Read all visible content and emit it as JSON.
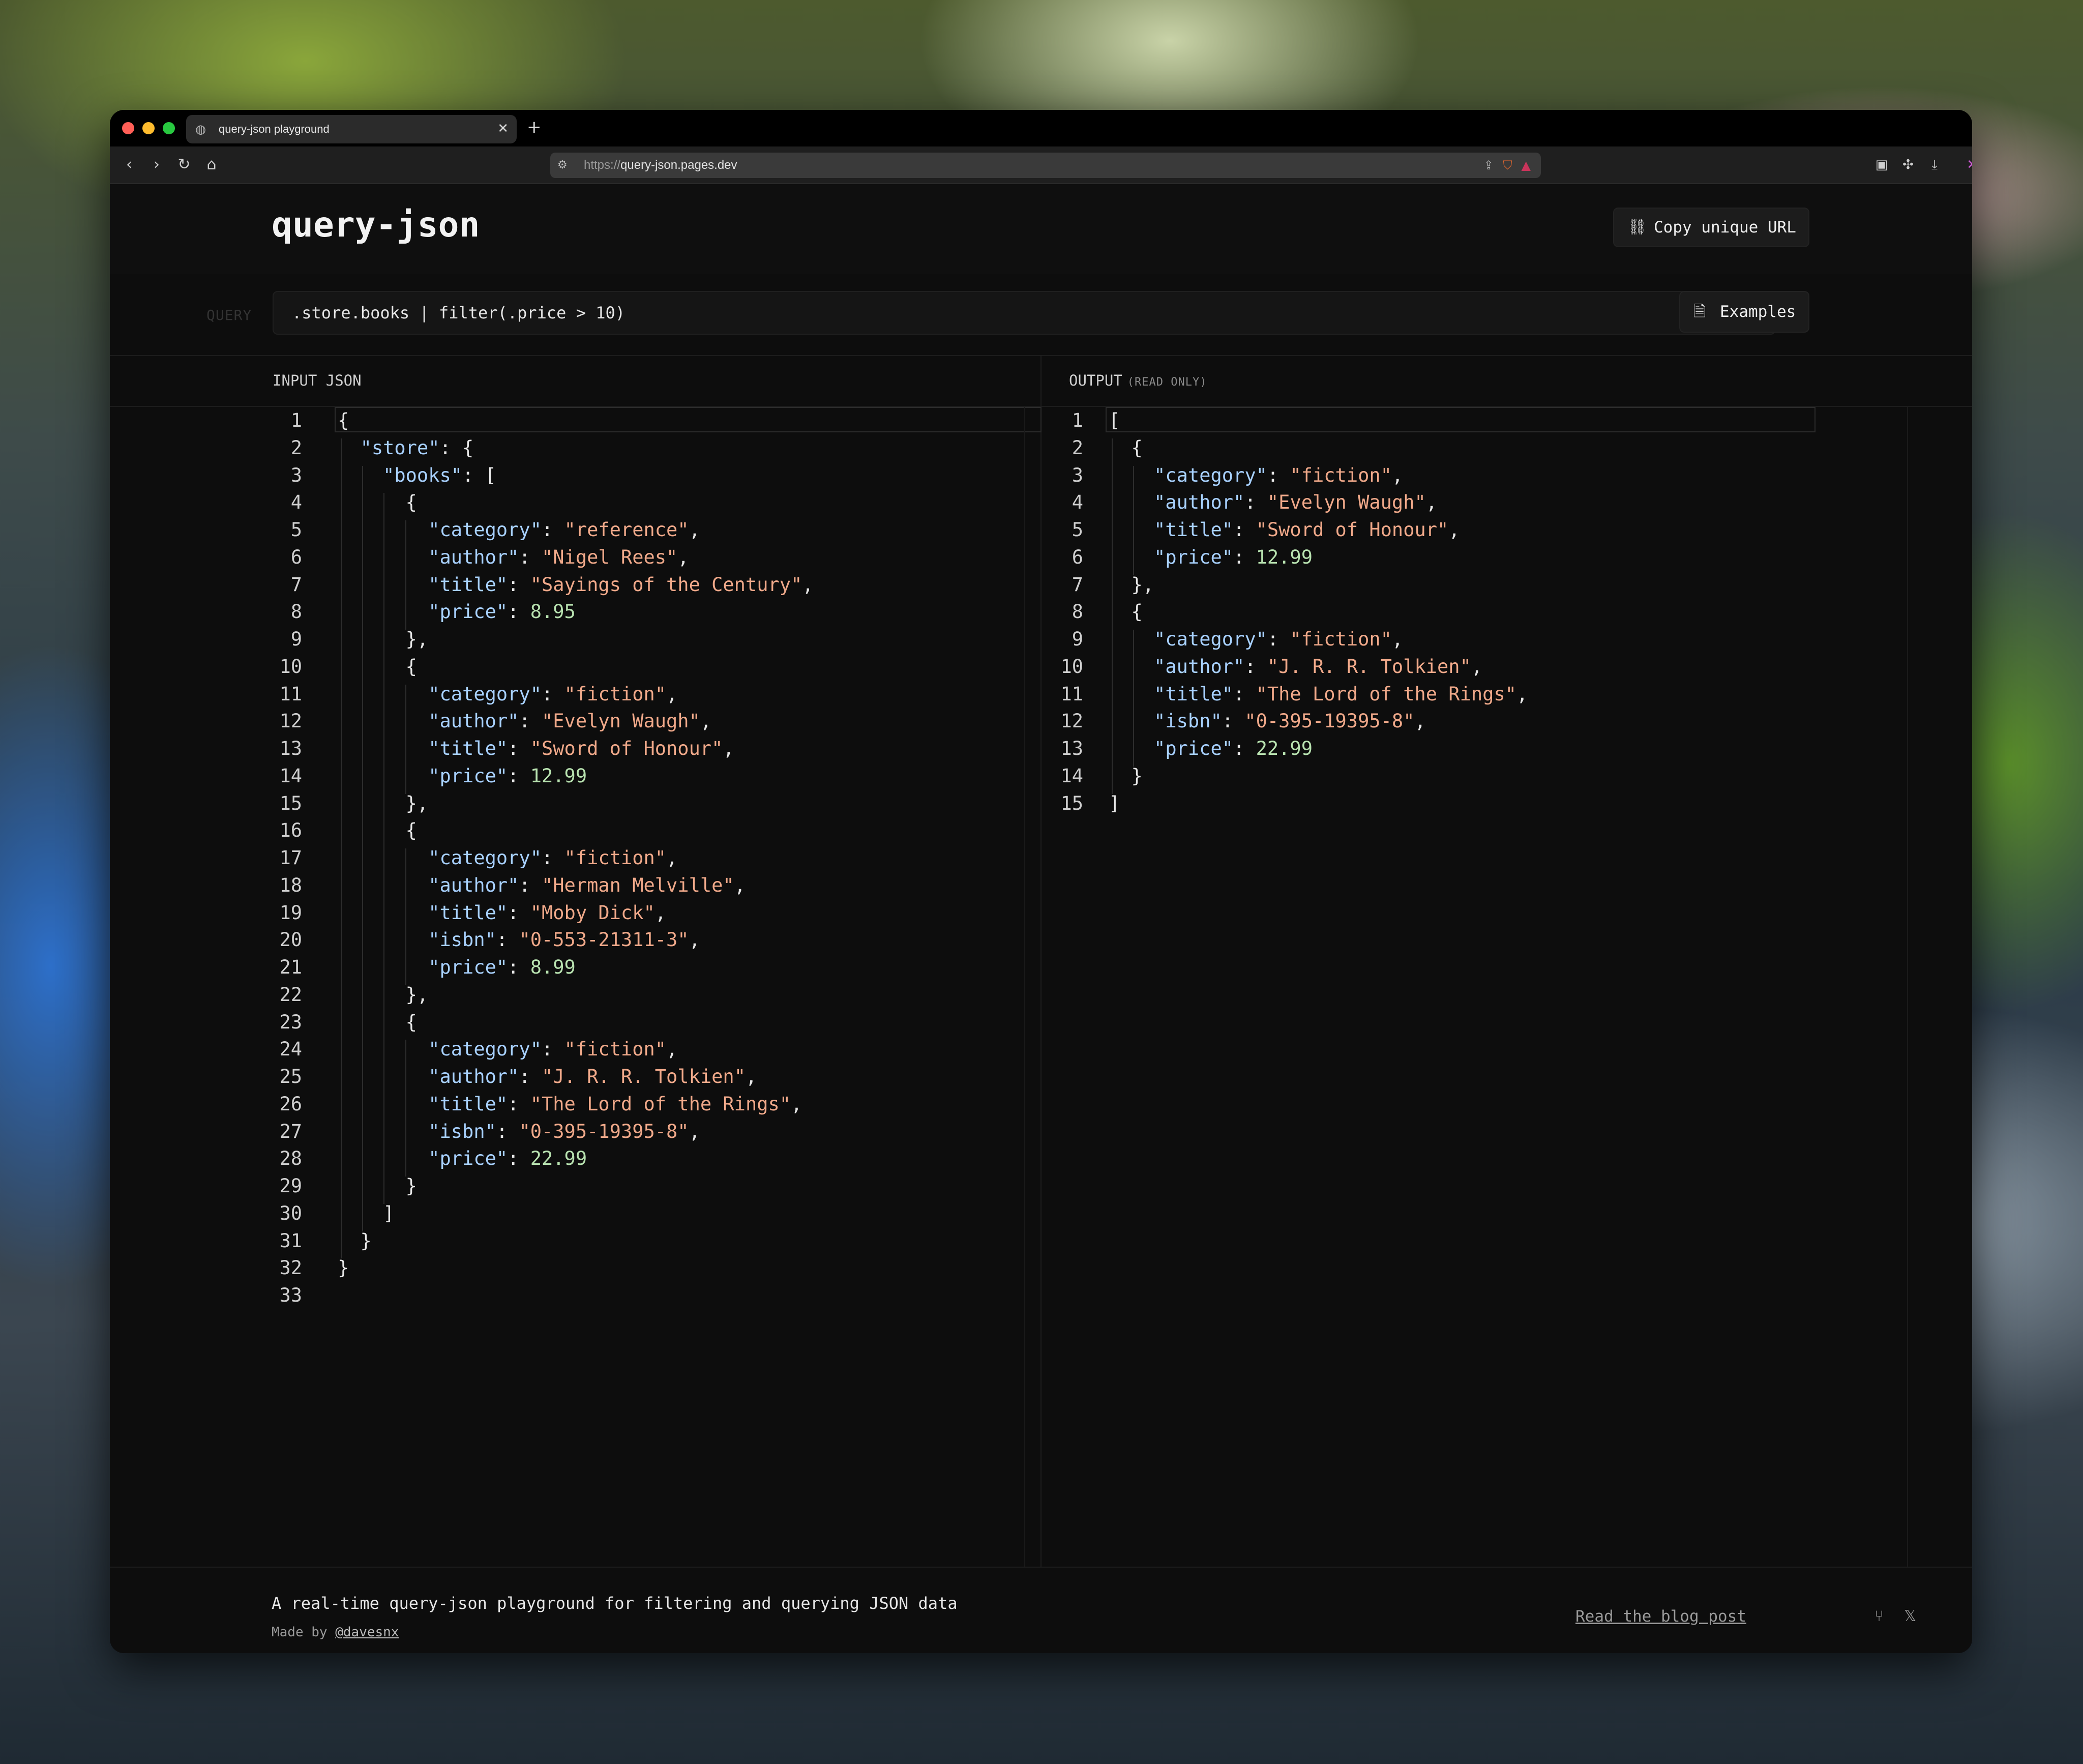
{
  "browser": {
    "tab_title": "query-json playground",
    "tab_close": "✕",
    "new_tab": "+",
    "url_scheme": "https://",
    "url_host": "query-json.pages.dev"
  },
  "app": {
    "brand": "query-json",
    "copy_url_label": "Copy unique URL",
    "query_label": "QUERY",
    "query_value": ".store.books | filter(.price > 10)",
    "examples_label": "Examples",
    "input_heading": "INPUT JSON",
    "output_heading": "OUTPUT",
    "output_sub": "(READ ONLY)"
  },
  "input_lines": [
    [
      [
        "p",
        "{"
      ]
    ],
    [
      [
        "p",
        "  "
      ],
      [
        "k",
        "\"store\""
      ],
      [
        "p",
        ": {"
      ]
    ],
    [
      [
        "p",
        "    "
      ],
      [
        "k",
        "\"books\""
      ],
      [
        "p",
        ": ["
      ]
    ],
    [
      [
        "p",
        "      {"
      ]
    ],
    [
      [
        "p",
        "        "
      ],
      [
        "k",
        "\"category\""
      ],
      [
        "p",
        ": "
      ],
      [
        "s",
        "\"reference\""
      ],
      [
        "p",
        ","
      ]
    ],
    [
      [
        "p",
        "        "
      ],
      [
        "k",
        "\"author\""
      ],
      [
        "p",
        ": "
      ],
      [
        "s",
        "\"Nigel Rees\""
      ],
      [
        "p",
        ","
      ]
    ],
    [
      [
        "p",
        "        "
      ],
      [
        "k",
        "\"title\""
      ],
      [
        "p",
        ": "
      ],
      [
        "s",
        "\"Sayings of the Century\""
      ],
      [
        "p",
        ","
      ]
    ],
    [
      [
        "p",
        "        "
      ],
      [
        "k",
        "\"price\""
      ],
      [
        "p",
        ": "
      ],
      [
        "n",
        "8.95"
      ]
    ],
    [
      [
        "p",
        "      },"
      ]
    ],
    [
      [
        "p",
        "      {"
      ]
    ],
    [
      [
        "p",
        "        "
      ],
      [
        "k",
        "\"category\""
      ],
      [
        "p",
        ": "
      ],
      [
        "s",
        "\"fiction\""
      ],
      [
        "p",
        ","
      ]
    ],
    [
      [
        "p",
        "        "
      ],
      [
        "k",
        "\"author\""
      ],
      [
        "p",
        ": "
      ],
      [
        "s",
        "\"Evelyn Waugh\""
      ],
      [
        "p",
        ","
      ]
    ],
    [
      [
        "p",
        "        "
      ],
      [
        "k",
        "\"title\""
      ],
      [
        "p",
        ": "
      ],
      [
        "s",
        "\"Sword of Honour\""
      ],
      [
        "p",
        ","
      ]
    ],
    [
      [
        "p",
        "        "
      ],
      [
        "k",
        "\"price\""
      ],
      [
        "p",
        ": "
      ],
      [
        "n",
        "12.99"
      ]
    ],
    [
      [
        "p",
        "      },"
      ]
    ],
    [
      [
        "p",
        "      {"
      ]
    ],
    [
      [
        "p",
        "        "
      ],
      [
        "k",
        "\"category\""
      ],
      [
        "p",
        ": "
      ],
      [
        "s",
        "\"fiction\""
      ],
      [
        "p",
        ","
      ]
    ],
    [
      [
        "p",
        "        "
      ],
      [
        "k",
        "\"author\""
      ],
      [
        "p",
        ": "
      ],
      [
        "s",
        "\"Herman Melville\""
      ],
      [
        "p",
        ","
      ]
    ],
    [
      [
        "p",
        "        "
      ],
      [
        "k",
        "\"title\""
      ],
      [
        "p",
        ": "
      ],
      [
        "s",
        "\"Moby Dick\""
      ],
      [
        "p",
        ","
      ]
    ],
    [
      [
        "p",
        "        "
      ],
      [
        "k",
        "\"isbn\""
      ],
      [
        "p",
        ": "
      ],
      [
        "s",
        "\"0-553-21311-3\""
      ],
      [
        "p",
        ","
      ]
    ],
    [
      [
        "p",
        "        "
      ],
      [
        "k",
        "\"price\""
      ],
      [
        "p",
        ": "
      ],
      [
        "n",
        "8.99"
      ]
    ],
    [
      [
        "p",
        "      },"
      ]
    ],
    [
      [
        "p",
        "      {"
      ]
    ],
    [
      [
        "p",
        "        "
      ],
      [
        "k",
        "\"category\""
      ],
      [
        "p",
        ": "
      ],
      [
        "s",
        "\"fiction\""
      ],
      [
        "p",
        ","
      ]
    ],
    [
      [
        "p",
        "        "
      ],
      [
        "k",
        "\"author\""
      ],
      [
        "p",
        ": "
      ],
      [
        "s",
        "\"J. R. R. Tolkien\""
      ],
      [
        "p",
        ","
      ]
    ],
    [
      [
        "p",
        "        "
      ],
      [
        "k",
        "\"title\""
      ],
      [
        "p",
        ": "
      ],
      [
        "s",
        "\"The Lord of the Rings\""
      ],
      [
        "p",
        ","
      ]
    ],
    [
      [
        "p",
        "        "
      ],
      [
        "k",
        "\"isbn\""
      ],
      [
        "p",
        ": "
      ],
      [
        "s",
        "\"0-395-19395-8\""
      ],
      [
        "p",
        ","
      ]
    ],
    [
      [
        "p",
        "        "
      ],
      [
        "k",
        "\"price\""
      ],
      [
        "p",
        ": "
      ],
      [
        "n",
        "22.99"
      ]
    ],
    [
      [
        "p",
        "      }"
      ]
    ],
    [
      [
        "p",
        "    ]"
      ]
    ],
    [
      [
        "p",
        "  }"
      ]
    ],
    [
      [
        "p",
        "}"
      ]
    ],
    [
      [
        "p",
        ""
      ]
    ]
  ],
  "output_lines": [
    [
      [
        "p",
        "["
      ]
    ],
    [
      [
        "p",
        "  {"
      ]
    ],
    [
      [
        "p",
        "    "
      ],
      [
        "k",
        "\"category\""
      ],
      [
        "p",
        ": "
      ],
      [
        "s",
        "\"fiction\""
      ],
      [
        "p",
        ","
      ]
    ],
    [
      [
        "p",
        "    "
      ],
      [
        "k",
        "\"author\""
      ],
      [
        "p",
        ": "
      ],
      [
        "s",
        "\"Evelyn Waugh\""
      ],
      [
        "p",
        ","
      ]
    ],
    [
      [
        "p",
        "    "
      ],
      [
        "k",
        "\"title\""
      ],
      [
        "p",
        ": "
      ],
      [
        "s",
        "\"Sword of Honour\""
      ],
      [
        "p",
        ","
      ]
    ],
    [
      [
        "p",
        "    "
      ],
      [
        "k",
        "\"price\""
      ],
      [
        "p",
        ": "
      ],
      [
        "n",
        "12.99"
      ]
    ],
    [
      [
        "p",
        "  },"
      ]
    ],
    [
      [
        "p",
        "  {"
      ]
    ],
    [
      [
        "p",
        "    "
      ],
      [
        "k",
        "\"category\""
      ],
      [
        "p",
        ": "
      ],
      [
        "s",
        "\"fiction\""
      ],
      [
        "p",
        ","
      ]
    ],
    [
      [
        "p",
        "    "
      ],
      [
        "k",
        "\"author\""
      ],
      [
        "p",
        ": "
      ],
      [
        "s",
        "\"J. R. R. Tolkien\""
      ],
      [
        "p",
        ","
      ]
    ],
    [
      [
        "p",
        "    "
      ],
      [
        "k",
        "\"title\""
      ],
      [
        "p",
        ": "
      ],
      [
        "s",
        "\"The Lord of the Rings\""
      ],
      [
        "p",
        ","
      ]
    ],
    [
      [
        "p",
        "    "
      ],
      [
        "k",
        "\"isbn\""
      ],
      [
        "p",
        ": "
      ],
      [
        "s",
        "\"0-395-19395-8\""
      ],
      [
        "p",
        ","
      ]
    ],
    [
      [
        "p",
        "    "
      ],
      [
        "k",
        "\"price\""
      ],
      [
        "p",
        ": "
      ],
      [
        "n",
        "22.99"
      ]
    ],
    [
      [
        "p",
        "  }"
      ]
    ],
    [
      [
        "p",
        "]"
      ]
    ]
  ],
  "footer": {
    "tagline": "A real-time query-json playground for filtering and querying JSON data",
    "made_by_prefix": "Made by ",
    "made_by_handle": "@davesnx",
    "blog_link": "Read the blog post"
  },
  "icons": {
    "back": "back-icon",
    "forward": "forward-icon",
    "reload": "reload-icon",
    "home": "home-icon",
    "link": "link-icon",
    "file": "file-icon",
    "clear": "clear-icon",
    "github": "github-icon",
    "x": "x-icon"
  }
}
